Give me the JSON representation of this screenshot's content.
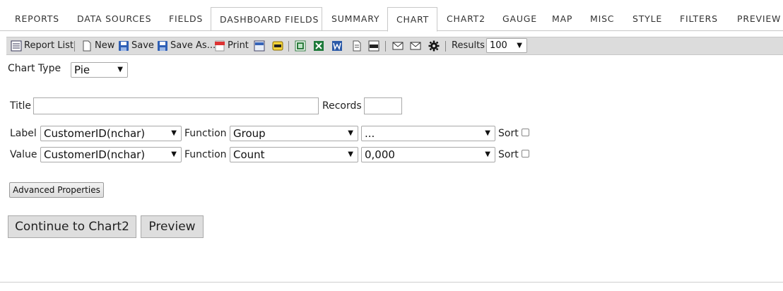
{
  "tabs": [
    {
      "label": "REPORTS"
    },
    {
      "label": "DATA SOURCES"
    },
    {
      "label": "FIELDS"
    },
    {
      "label": "DASHBOARD FIELDS"
    },
    {
      "label": "SUMMARY"
    },
    {
      "label": "CHART",
      "active": true
    },
    {
      "label": "CHART2"
    },
    {
      "label": "GAUGE"
    },
    {
      "label": "MAP"
    },
    {
      "label": "MISC"
    },
    {
      "label": "STYLE"
    },
    {
      "label": "FILTERS"
    },
    {
      "label": "PREVIEW"
    }
  ],
  "toolbar": {
    "report_list": "Report List",
    "new": "New",
    "save": "Save",
    "save_as": "Save As...",
    "print": "Print",
    "results_label": "Results",
    "results_value": "100"
  },
  "form": {
    "chart_type_label": "Chart Type",
    "chart_type_value": "Pie",
    "title_label": "Title",
    "title_value": "",
    "records_label": "Records",
    "records_value": "",
    "label_row": {
      "label": "Label",
      "field": "CustomerID(nchar)",
      "function_label": "Function",
      "function": "Group",
      "format": "...",
      "sort_label": "Sort"
    },
    "value_row": {
      "label": "Value",
      "field": "CustomerID(nchar)",
      "function_label": "Function",
      "function": "Count",
      "format": "0,000",
      "sort_label": "Sort"
    },
    "advanced_properties": "Advanced Properties",
    "continue_button": "Continue to Chart2",
    "preview_button": "Preview"
  }
}
